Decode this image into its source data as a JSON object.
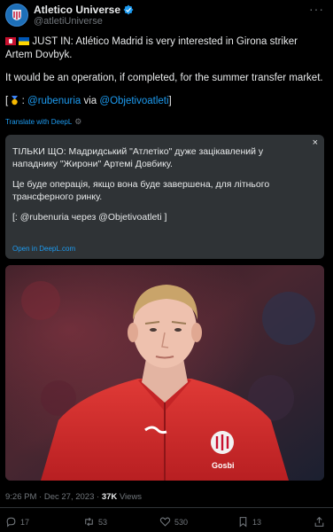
{
  "account": {
    "display_name": "Atletico Universe",
    "handle": "@atletiUniverse"
  },
  "tweet": {
    "paragraph1": "JUST IN: Atlético Madrid is very interested in Girona striker Artem Dovbyk.",
    "paragraph2": "It would be an operation, if completed, for the summer transfer market.",
    "credits_open": "[",
    "credits_sep": ":",
    "mention1": "@rubenuria",
    "via": "via",
    "mention2": "@Objetivoatleti",
    "credits_close": "]",
    "translate_link": "Translate with DeepL"
  },
  "translation_card": {
    "paragraph1": " ТІЛЬКИ ЩО: Мадридський \"Атлетіко\" дуже зацікавлений у нападнику \"Жирони\" Артемі Довбику.",
    "paragraph2": "Це буде операція, якщо вона буде завершена, для літнього трансферного ринку.",
    "paragraph3": "[: @rubenuria через @Objetivoatleti ]",
    "open_link": "Open in DeepL.com",
    "close_label": "×"
  },
  "meta": {
    "time": "9:26 PM",
    "sep1": "·",
    "date": "Dec 27, 2023",
    "sep2": "·",
    "views_count": "37K",
    "views_label": "Views"
  },
  "actions": {
    "replies": "17",
    "retweets": "53",
    "likes": "530",
    "bookmarks": "13"
  },
  "colors": {
    "background": "#000000",
    "text": "#e7e9ea",
    "secondary": "#71767b",
    "accent": "#1d9bf0",
    "card": "#2f3336",
    "jersey": "#d42a2a"
  }
}
